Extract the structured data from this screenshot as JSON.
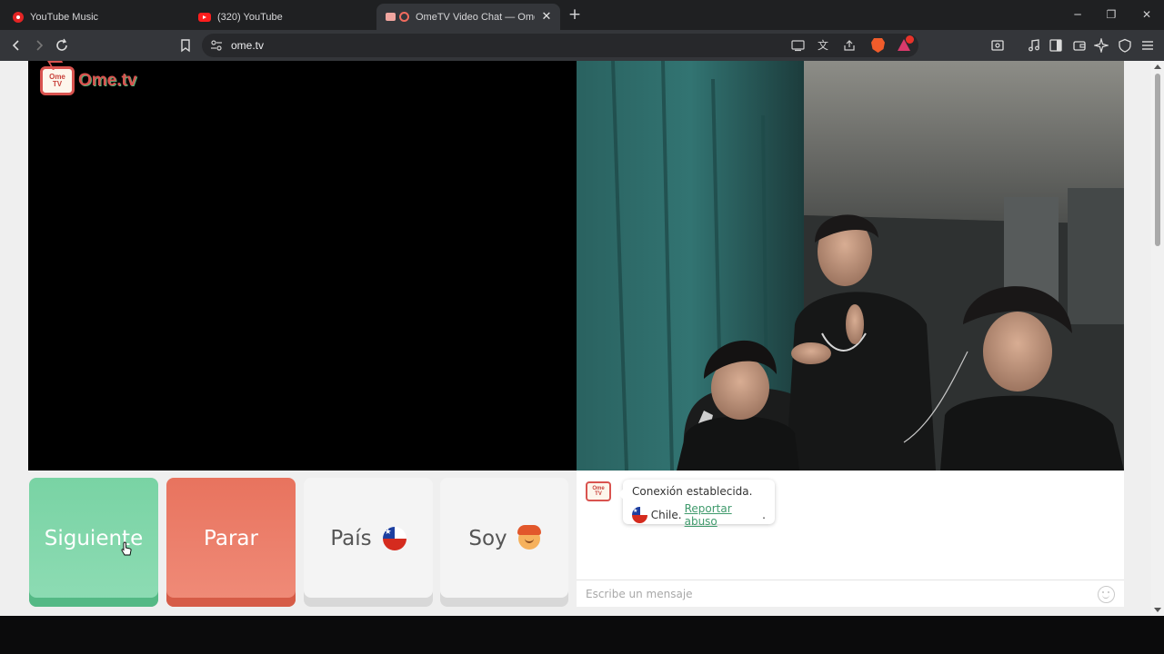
{
  "browser": {
    "tabs": [
      {
        "title": "YouTube Music",
        "icon": "youtube-music-icon"
      },
      {
        "title": "(320) YouTube",
        "icon": "youtube-icon"
      },
      {
        "title": "OmeTV Video Chat — Omegl",
        "icon": "ometv-icon",
        "active": true
      }
    ],
    "url": "ome.tv",
    "accent": "#34363a"
  },
  "site": {
    "logo_text": "Ome.tv",
    "logo_badge_top": "Ome",
    "logo_badge_bottom": "TV"
  },
  "controls": {
    "next_label": "Siguiente",
    "stop_label": "Parar",
    "country_label": "País",
    "gender_label": "Soy",
    "next_color": "#79d3a4",
    "stop_color": "#e8735e"
  },
  "chat": {
    "status": "Conexión establecida.",
    "country": "Chile.",
    "report_link": "Reportar abuso",
    "report_suffix": ".",
    "input_placeholder": "Escribe un mensaje"
  }
}
